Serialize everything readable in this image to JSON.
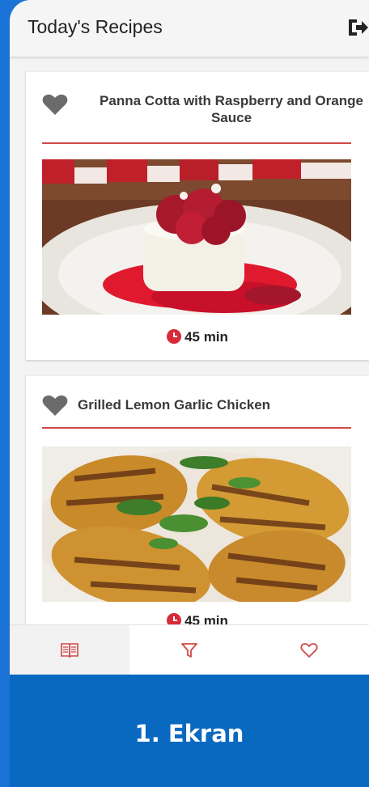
{
  "appbar": {
    "title": "Today's Recipes"
  },
  "recipes": [
    {
      "title": "Panna Cotta with Raspberry and Orange Sauce",
      "time": "45 min",
      "favorited": false
    },
    {
      "title": "Grilled Lemon Garlic Chicken",
      "time": "45 min",
      "favorited": false
    }
  ],
  "nav": {
    "items": [
      {
        "icon": "recipe-book-icon",
        "active": true
      },
      {
        "icon": "filter-icon",
        "active": false
      },
      {
        "icon": "heart-outline-icon",
        "active": false
      }
    ]
  },
  "banner": {
    "label": "1. Ekran"
  },
  "colors": {
    "accent": "#d04848",
    "banner": "#0969c0",
    "frame": "#1a72d6"
  }
}
